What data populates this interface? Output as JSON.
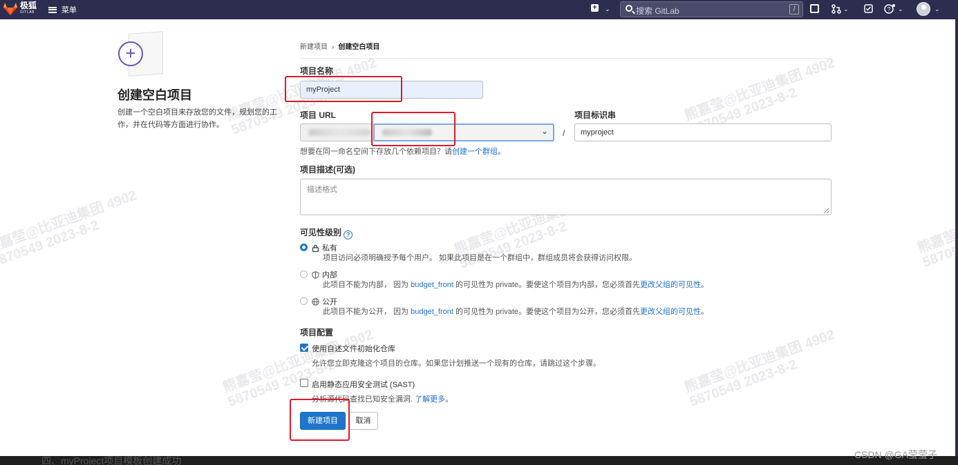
{
  "nav": {
    "brand_cn": "极狐",
    "brand_en": "GITLAB",
    "menu_label": "菜单",
    "search_placeholder": "搜索 GitLab",
    "search_shortcut": "/",
    "plus_icon": "+"
  },
  "sidebar_panel": {
    "title": "创建空白项目",
    "description": "创建一个空白项目来存放您的文件，规划您的工作，并在代码等方面进行协作。"
  },
  "breadcrumb": {
    "parent": "新建项目",
    "separator": "›",
    "current": "创建空白项目"
  },
  "form": {
    "name_label": "项目名称",
    "name_value": "myProject",
    "url_label": "项目 URL",
    "slash": "/",
    "slug_label": "项目标识串",
    "slug_value": "myproject",
    "group_help_prefix": "想要在同一命名空间下存放几个依赖项目？请",
    "group_help_link": "创建一个群组",
    "group_help_suffix": "。",
    "desc_label": "项目描述(可选)",
    "desc_placeholder": "描述格式",
    "visibility_label": "可见性级别",
    "visibility_help_icon": "?",
    "visibility": [
      {
        "label": "私有",
        "icon": "lock-icon",
        "selected": true,
        "desc_parts": [
          "项目访问必须明确授予每个用户。 如果此项目是在一个群组中，群组成员将会获得访问权限。"
        ]
      },
      {
        "label": "内部",
        "icon": "shield-icon",
        "selected": false,
        "desc_a": "此项目不能为内部， 因为 ",
        "desc_link1": "budget_front",
        "desc_b": " 的可见性为 private。要使这个项目为内部，您必须首先",
        "desc_link2": "更改父组的可见性",
        "desc_c": "。"
      },
      {
        "label": "公开",
        "icon": "globe-icon",
        "selected": false,
        "desc_a": "此项目不能为公开， 因为 ",
        "desc_link1": "budget_front",
        "desc_b": " 的可见性为 private。要使这个项目为公开，您必须首先",
        "desc_link2": "更改父组的可见性",
        "desc_c": "。"
      }
    ],
    "config_label": "项目配置",
    "readme_label": "使用自述文件初始化仓库",
    "readme_checked": true,
    "readme_desc": "允许您立即克隆这个项目的仓库。如果您计划推送一个现有的仓库，请跳过这个步骤。",
    "sast_label": "启用静态应用安全测试 (SAST)",
    "sast_checked": false,
    "sast_desc": "分析源代码查找已知安全漏洞.",
    "sast_link": "了解更多",
    "sast_desc_end": "。",
    "create_button": "新建项目",
    "cancel_button": "取消"
  },
  "watermark": {
    "line1": "熊嘉莹@比亚迪集团 4902",
    "line2": "5870549 2023-8-2"
  },
  "footer": {
    "csdn": "CSDN @GA莹莹子",
    "cut_text": "四、myProject项目模板创建成功"
  },
  "colors": {
    "nav_bg": "#2d2d4f",
    "primary": "#1f75cb",
    "link": "#1f6fd6",
    "annotation_red": "#e3172a",
    "accent_purple": "#6b4fbb"
  }
}
